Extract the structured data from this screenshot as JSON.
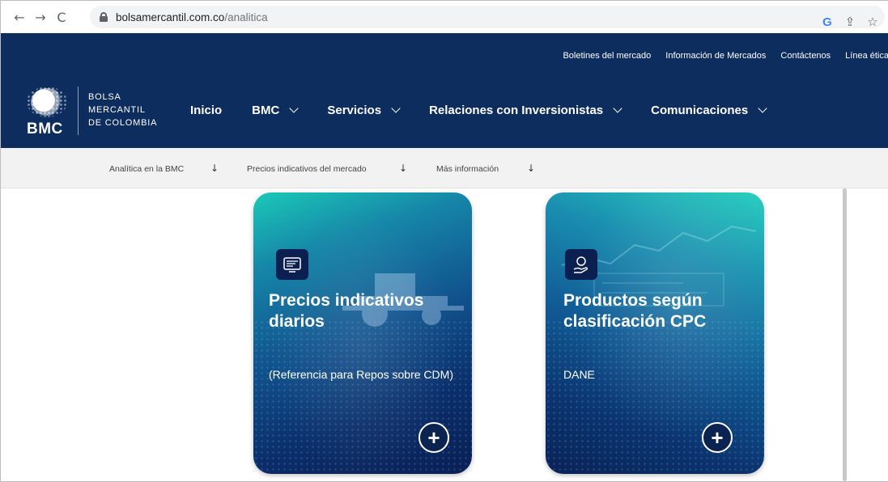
{
  "browser": {
    "url_domain": "bolsamercantil.com.co",
    "url_path": "/analitica",
    "back_icon": "←",
    "forward_icon": "→",
    "reload_icon": "C",
    "google_icon": "G",
    "share_icon": "⇪",
    "star_icon": "☆"
  },
  "header": {
    "top_links": [
      "Boletines del mercado",
      "Información de Mercados",
      "Contáctenos",
      "Línea ética"
    ],
    "logo_text": "BMC",
    "brand_lines": [
      "BOLSA",
      "MERCANTIL",
      "DE COLOMBIA"
    ],
    "nav": [
      "Inicio",
      "BMC",
      "Servicios",
      "Relaciones con Inversionistas",
      "Comunicaciones"
    ]
  },
  "sub_nav": {
    "items": [
      "Analítica en la BMC",
      "Precios indicativos del mercado",
      "Más información"
    ],
    "arrow": "↓"
  },
  "cards": [
    {
      "icon": "document-screen-icon",
      "title": "Precios indicativos diarios",
      "description": "(Referencia para Repos sobre CDM)",
      "action": "+"
    },
    {
      "icon": "coin-hand-icon",
      "title": "Productos según clasificación CPC",
      "description": "DANE",
      "action": "+"
    }
  ],
  "colors": {
    "header_bg": "#0d2d5e",
    "sub_nav_bg": "#f2f2f2"
  }
}
